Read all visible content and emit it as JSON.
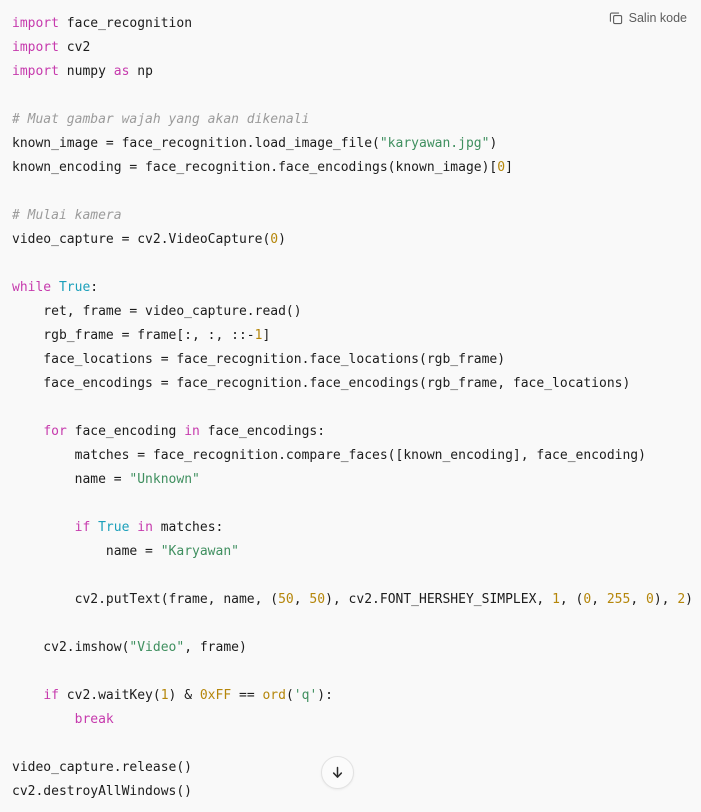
{
  "toolbar": {
    "copy_label": "Salin kode",
    "copy_icon": "copy-icon"
  },
  "scroll": {
    "icon": "arrow-down-icon"
  },
  "colors": {
    "background": "#f9f9f9",
    "text": "#1c1c1c",
    "keyword": "#c63aad",
    "constant": "#1a9fba",
    "string": "#3f8f5f",
    "number": "#b5860a",
    "builtin": "#b5860a",
    "comment": "#9b9b9b",
    "toolbar_text": "#5d5d5d"
  },
  "code": {
    "language": "python",
    "lines": [
      "import face_recognition",
      "import cv2",
      "import numpy as np",
      "",
      "# Muat gambar wajah yang akan dikenali",
      "known_image = face_recognition.load_image_file(\"karyawan.jpg\")",
      "known_encoding = face_recognition.face_encodings(known_image)[0]",
      "",
      "# Mulai kamera",
      "video_capture = cv2.VideoCapture(0)",
      "",
      "while True:",
      "    ret, frame = video_capture.read()",
      "    rgb_frame = frame[:, :, ::-1]",
      "    face_locations = face_recognition.face_locations(rgb_frame)",
      "    face_encodings = face_recognition.face_encodings(rgb_frame, face_locations)",
      "",
      "    for face_encoding in face_encodings:",
      "        matches = face_recognition.compare_faces([known_encoding], face_encoding)",
      "        name = \"Unknown\"",
      "",
      "        if True in matches:",
      "            name = \"Karyawan\"",
      "",
      "        cv2.putText(frame, name, (50, 50), cv2.FONT_HERSHEY_SIMPLEX, 1, (0, 255, 0), 2)",
      "",
      "    cv2.imshow(\"Video\", frame)",
      "",
      "    if cv2.waitKey(1) & 0xFF == ord('q'):",
      "        break",
      "",
      "video_capture.release()",
      "cv2.destroyAllWindows()"
    ],
    "tokens": [
      [
        [
          "import",
          "kw"
        ],
        [
          " face_recognition",
          "plain"
        ]
      ],
      [
        [
          "import",
          "kw"
        ],
        [
          " cv2",
          "plain"
        ]
      ],
      [
        [
          "import",
          "kw"
        ],
        [
          " numpy ",
          "plain"
        ],
        [
          "as",
          "kw"
        ],
        [
          " np",
          "plain"
        ]
      ],
      [],
      [
        [
          "# Muat gambar wajah yang akan dikenali",
          "com"
        ]
      ],
      [
        [
          "known_image = face_recognition.load_image_file(",
          "plain"
        ],
        [
          "\"karyawan.jpg\"",
          "str"
        ],
        [
          ")",
          "plain"
        ]
      ],
      [
        [
          "known_encoding = face_recognition.face_encodings(known_image)[",
          "plain"
        ],
        [
          "0",
          "num"
        ],
        [
          "]",
          "plain"
        ]
      ],
      [],
      [
        [
          "# Mulai kamera",
          "com"
        ]
      ],
      [
        [
          "video_capture = cv2.VideoCapture(",
          "plain"
        ],
        [
          "0",
          "num"
        ],
        [
          ")",
          "plain"
        ]
      ],
      [],
      [
        [
          "while",
          "kw"
        ],
        [
          " ",
          "plain"
        ],
        [
          "True",
          "const"
        ],
        [
          ":",
          "plain"
        ]
      ],
      [
        [
          "    ret, frame = video_capture.read()",
          "plain"
        ]
      ],
      [
        [
          "    rgb_frame = frame[:, :, ::-",
          "plain"
        ],
        [
          "1",
          "num"
        ],
        [
          "]",
          "plain"
        ]
      ],
      [
        [
          "    face_locations = face_recognition.face_locations(rgb_frame)",
          "plain"
        ]
      ],
      [
        [
          "    face_encodings = face_recognition.face_encodings(rgb_frame, face_locations)",
          "plain"
        ]
      ],
      [],
      [
        [
          "    ",
          "plain"
        ],
        [
          "for",
          "kw"
        ],
        [
          " face_encoding ",
          "plain"
        ],
        [
          "in",
          "kw"
        ],
        [
          " face_encodings:",
          "plain"
        ]
      ],
      [
        [
          "        matches = face_recognition.compare_faces([known_encoding], face_encoding)",
          "plain"
        ]
      ],
      [
        [
          "        name = ",
          "plain"
        ],
        [
          "\"Unknown\"",
          "str"
        ]
      ],
      [],
      [
        [
          "        ",
          "plain"
        ],
        [
          "if",
          "kw"
        ],
        [
          " ",
          "plain"
        ],
        [
          "True",
          "const"
        ],
        [
          " ",
          "plain"
        ],
        [
          "in",
          "kw"
        ],
        [
          " matches:",
          "plain"
        ]
      ],
      [
        [
          "            name = ",
          "plain"
        ],
        [
          "\"Karyawan\"",
          "str"
        ]
      ],
      [],
      [
        [
          "        cv2.putText(frame, name, (",
          "plain"
        ],
        [
          "50",
          "num"
        ],
        [
          ", ",
          "plain"
        ],
        [
          "50",
          "num"
        ],
        [
          "), cv2.FONT_HERSHEY_SIMPLEX, ",
          "plain"
        ],
        [
          "1",
          "num"
        ],
        [
          ", (",
          "plain"
        ],
        [
          "0",
          "num"
        ],
        [
          ", ",
          "plain"
        ],
        [
          "255",
          "num"
        ],
        [
          ", ",
          "plain"
        ],
        [
          "0",
          "num"
        ],
        [
          "), ",
          "plain"
        ],
        [
          "2",
          "num"
        ],
        [
          ")",
          "plain"
        ]
      ],
      [],
      [
        [
          "    cv2.imshow(",
          "plain"
        ],
        [
          "\"Video\"",
          "str"
        ],
        [
          ", frame)",
          "plain"
        ]
      ],
      [],
      [
        [
          "    ",
          "plain"
        ],
        [
          "if",
          "kw"
        ],
        [
          " cv2.waitKey(",
          "plain"
        ],
        [
          "1",
          "num"
        ],
        [
          ") & ",
          "plain"
        ],
        [
          "0xFF",
          "num"
        ],
        [
          " == ",
          "plain"
        ],
        [
          "ord",
          "builtin"
        ],
        [
          "(",
          "plain"
        ],
        [
          "'q'",
          "str"
        ],
        [
          "):",
          "plain"
        ]
      ],
      [
        [
          "        ",
          "plain"
        ],
        [
          "break",
          "kw"
        ]
      ],
      [],
      [
        [
          "video_capture.release()",
          "plain"
        ]
      ],
      [
        [
          "cv2.destroyAllWindows()",
          "plain"
        ]
      ]
    ]
  }
}
